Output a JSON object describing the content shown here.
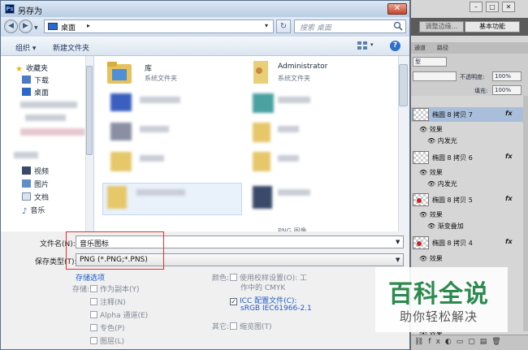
{
  "dialog": {
    "title": "另存为",
    "close": "✕",
    "address": {
      "location": "桌面",
      "separator": "▸"
    },
    "search_placeholder": "搜索 桌面",
    "toolbar": {
      "organize": "组织 ▾",
      "new_folder": "新建文件夹",
      "view_drop": "▾",
      "help": "?"
    },
    "nav": {
      "favorites": "收藏夹",
      "downloads": "下载",
      "desktop": "桌面",
      "videos": "视频",
      "pictures": "图片",
      "documents": "文档",
      "music": "音乐"
    },
    "files": [
      {
        "name": "库",
        "sub": "系统文件夹"
      },
      {
        "name": "Administrator",
        "sub": "系统文件夹"
      },
      {
        "name": "",
        "sub": "PNG 图像"
      }
    ],
    "form": {
      "filename_label": "文件名(N):",
      "filename_value": "音乐图标",
      "filetype_label": "保存类型(T):",
      "filetype_value": "PNG (*.PNG;*.PNS)",
      "save_options": "存储选项",
      "store_label": "存储:",
      "as_copy": "作为副本(Y)",
      "notes": "注释(N)",
      "alpha": "Alpha 通道(E)",
      "spot": "专色(P)",
      "layers": "图层(L)",
      "color_label": "颜色:",
      "proof": "使用校样设置(O): 工",
      "proof2": "作中的 CMYK",
      "icc": "ICC 配置文件(C):",
      "icc2": "sRGB IEC61966-2.1",
      "other_label": "其它:",
      "thumb": "缩览图(T)"
    }
  },
  "photoshop": {
    "win_buttons": [
      "–",
      "□",
      "✕"
    ],
    "essentials": "调整边缘...",
    "basic": "基本功能",
    "tabs": [
      "通道",
      "路径"
    ],
    "blend_mode": "型",
    "opacity_label": "不透明度:",
    "opacity": "100%",
    "fill_label": "填充:",
    "fill": "100%",
    "layers": [
      {
        "name": "椭圆 8 拷贝 7",
        "effect": "内发光"
      },
      {
        "name": "椭圆 8 拷贝 6",
        "effect": "内发光"
      },
      {
        "name": "椭圆 8 拷贝 5",
        "effect": "渐变叠加"
      },
      {
        "name": "椭圆 8 拷贝 4",
        "effect": ""
      }
    ],
    "effects_label": "效果",
    "fx": "fx",
    "bottom_effect": "效果"
  },
  "watermark": {
    "line1": "百科全说",
    "line2": "助你轻松解决"
  },
  "colors": {
    "accent_link": "#1f5bc1",
    "highlight_border": "#e2302a",
    "watermark": "#2c8a4e"
  }
}
